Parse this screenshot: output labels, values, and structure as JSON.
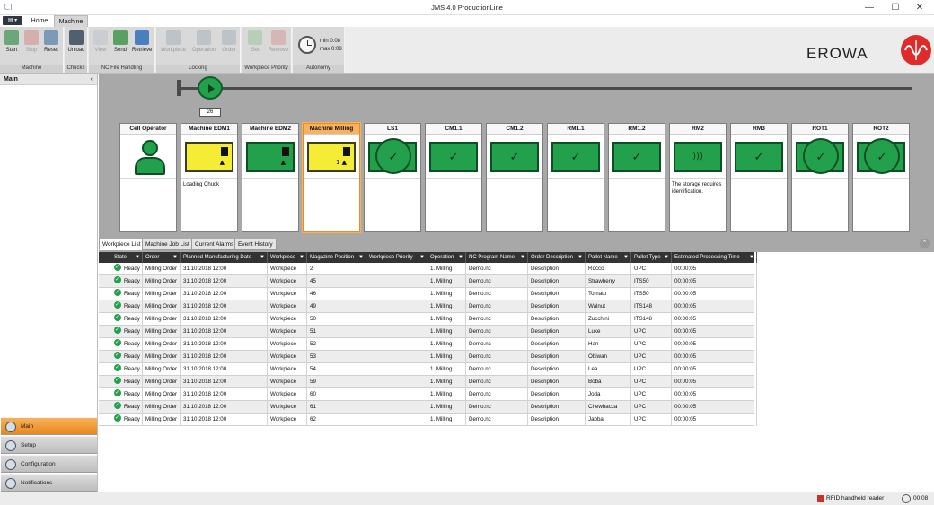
{
  "window": {
    "app_logo": "CI",
    "title": "JMS 4.0 ProductionLine",
    "minimize": "—",
    "maximize": "☐",
    "close": "✕"
  },
  "ribbon": {
    "app_menu": "▤ ▾",
    "tabs": {
      "home": "Home",
      "machine": "Machine"
    },
    "groups": {
      "machine": {
        "label": "Machine",
        "buttons": [
          "Start",
          "Stop",
          "Reset"
        ]
      },
      "chucks": {
        "label": "Chucks",
        "buttons": [
          "Unload"
        ]
      },
      "nc": {
        "label": "NC File Handling",
        "buttons": [
          "View",
          "Send",
          "Retrieve"
        ]
      },
      "locking": {
        "label": "Locking",
        "buttons": [
          "Workpiece",
          "Operation",
          "Order"
        ]
      },
      "priority": {
        "label": "Workpiece Priority",
        "buttons": [
          "Set",
          "Remove"
        ]
      },
      "autonomy": {
        "label": "Autonomy",
        "min": "min  0:08",
        "max": "max  0:08"
      }
    },
    "brand": "EROWA"
  },
  "leftnav": {
    "header": "Main",
    "collapse": "‹",
    "items": [
      "Main",
      "Setup",
      "Configuration",
      "Notifications"
    ]
  },
  "timeline": {
    "counter": "26"
  },
  "stations": [
    {
      "name": "Cell Operator",
      "status": ""
    },
    {
      "name": "Machine EDM1",
      "status": "Loading Chuck"
    },
    {
      "name": "Machine EDM2",
      "status": ""
    },
    {
      "name": "Machine Milling",
      "status": "",
      "mark": "1 ▲"
    },
    {
      "name": "LS1",
      "status": ""
    },
    {
      "name": "CM1.1",
      "status": ""
    },
    {
      "name": "CM1.2",
      "status": ""
    },
    {
      "name": "RM1.1",
      "status": ""
    },
    {
      "name": "RM1.2",
      "status": ""
    },
    {
      "name": "RM2",
      "status": "The storage requires identification."
    },
    {
      "name": "RM3",
      "status": ""
    },
    {
      "name": "ROT1",
      "status": ""
    },
    {
      "name": "ROT2",
      "status": ""
    }
  ],
  "grid": {
    "tabs": [
      "Workpiece List",
      "Machine Job List",
      "Current Alarms",
      "Event History"
    ],
    "filter_icon": "▼",
    "columns": [
      "State",
      "Order",
      "Planned Manufacturing Date",
      "Workpiece",
      "Magazine Position",
      "Workpiece Priority",
      "Operation",
      "NC Program Name",
      "Order Description",
      "Pallet Name",
      "Pallet Type",
      "Estimated Processing Time"
    ],
    "rows": [
      [
        "Ready",
        "Milling Order",
        "31.10.2018 12:00",
        "Workpiece",
        "2",
        "",
        "1. Milling",
        "Demo.nc",
        "Description",
        "Rocco",
        "UPC",
        "00:00:05"
      ],
      [
        "Ready",
        "Milling Order",
        "31.10.2018 12:00",
        "Workpiece",
        "45",
        "",
        "1. Milling",
        "Demo.nc",
        "Description",
        "Strawberry",
        "ITS50",
        "00:00:05"
      ],
      [
        "Ready",
        "Milling Order",
        "31.10.2018 12:00",
        "Workpiece",
        "46",
        "",
        "1. Milling",
        "Demo.nc",
        "Description",
        "Tomato",
        "ITS50",
        "00:00:05"
      ],
      [
        "Ready",
        "Milling Order",
        "31.10.2018 12:00",
        "Workpiece",
        "49",
        "",
        "1. Milling",
        "Demo.nc",
        "Description",
        "Walnut",
        "ITS148",
        "00:00:05"
      ],
      [
        "Ready",
        "Milling Order",
        "31.10.2018 12:00",
        "Workpiece",
        "50",
        "",
        "1. Milling",
        "Demo.nc",
        "Description",
        "Zucchini",
        "ITS148",
        "00:00:05"
      ],
      [
        "Ready",
        "Milling Order",
        "31.10.2018 12:00",
        "Workpiece",
        "51",
        "",
        "1. Milling",
        "Demo.nc",
        "Description",
        "Luke",
        "UPC",
        "00:00:05"
      ],
      [
        "Ready",
        "Milling Order",
        "31.10.2018 12:00",
        "Workpiece",
        "52",
        "",
        "1. Milling",
        "Demo.nc",
        "Description",
        "Han",
        "UPC",
        "00:00:05"
      ],
      [
        "Ready",
        "Milling Order",
        "31.10.2018 12:00",
        "Workpiece",
        "53",
        "",
        "1. Milling",
        "Demo.nc",
        "Description",
        "Obiwan",
        "UPC",
        "00:00:05"
      ],
      [
        "Ready",
        "Milling Order",
        "31.10.2018 12:00",
        "Workpiece",
        "54",
        "",
        "1. Milling",
        "Demo.nc",
        "Description",
        "Lea",
        "UPC",
        "00:00:05"
      ],
      [
        "Ready",
        "Milling Order",
        "31.10.2018 12:00",
        "Workpiece",
        "59",
        "",
        "1. Milling",
        "Demo.nc",
        "Description",
        "Boba",
        "UPC",
        "00:00:05"
      ],
      [
        "Ready",
        "Milling Order",
        "31.10.2018 12:00",
        "Workpiece",
        "60",
        "",
        "1. Milling",
        "Demo.nc",
        "Description",
        "Joda",
        "UPC",
        "00:00:05"
      ],
      [
        "Ready",
        "Milling Order",
        "31.10.2018 12:00",
        "Workpiece",
        "61",
        "",
        "1. Milling",
        "Demo.nc",
        "Description",
        "Chewbacca",
        "UPC",
        "00:00:05"
      ],
      [
        "Ready",
        "Milling Order",
        "31.10.2018 12:00",
        "Workpiece",
        "62",
        "",
        "1. Milling",
        "Demo.nc",
        "Description",
        "Jabba",
        "UPC",
        "00:00:05"
      ]
    ]
  },
  "statusbar": {
    "rfid": "RFID handheld reader",
    "time": "00:08"
  },
  "colors": {
    "ok": "#22a04b",
    "warn": "#f4ec35",
    "accent": "#e9871d",
    "brand_red": "#e02b2b"
  }
}
